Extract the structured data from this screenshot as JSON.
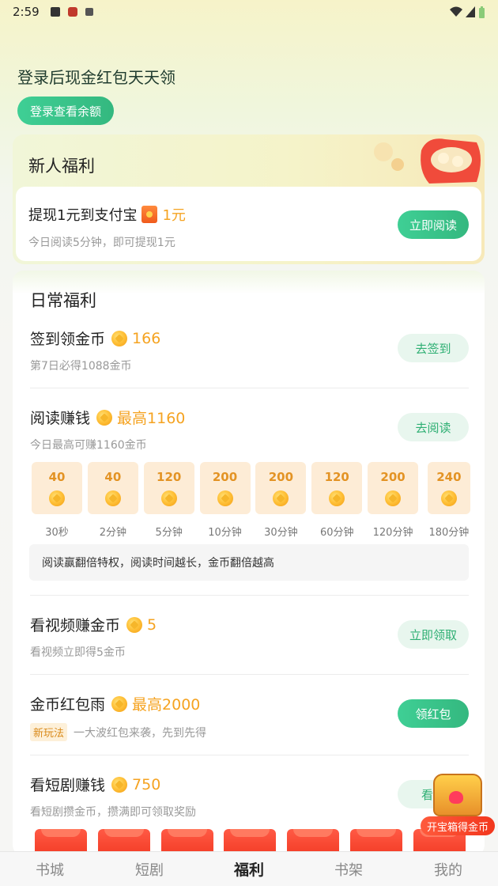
{
  "status": {
    "time": "2:59",
    "indicator_icons": [
      "stop-icon",
      "app-icon",
      "a-icon"
    ],
    "right_icons": [
      "wifi-icon",
      "signal-icon",
      "battery-icon"
    ]
  },
  "hero": {
    "title": "登录后现金红包天天领",
    "login_label": "登录查看余额"
  },
  "newbie": {
    "title": "新人福利",
    "task": {
      "title_prefix": "提现1元到支付宝",
      "amount": "1元",
      "desc": "今日阅读5分钟，即可提现1元",
      "button": "立即阅读"
    }
  },
  "daily": {
    "title": "日常福利",
    "checkin": {
      "name": "签到领金币",
      "reward": "166",
      "desc": "第7日必得1088金币",
      "button": "去签到"
    },
    "read": {
      "name": "阅读赚钱",
      "reward": "最高1160",
      "desc": "今日最高可赚1160金币",
      "button": "去阅读",
      "tiers": [
        {
          "value": "40",
          "label": "30秒"
        },
        {
          "value": "40",
          "label": "2分钟"
        },
        {
          "value": "120",
          "label": "5分钟"
        },
        {
          "value": "200",
          "label": "10分钟"
        },
        {
          "value": "200",
          "label": "30分钟"
        },
        {
          "value": "120",
          "label": "60分钟"
        },
        {
          "value": "200",
          "label": "120分钟"
        },
        {
          "value": "240",
          "label": "180分钟"
        }
      ],
      "tip": "阅读赢翻倍特权，阅读时间越长，金币翻倍越高"
    },
    "video": {
      "name": "看视频赚金币",
      "reward": "5",
      "desc": "看视频立即得5金币",
      "button": "立即领取"
    },
    "rain": {
      "name": "金币红包雨",
      "reward": "最高2000",
      "tag": "新玩法",
      "desc": "一大波红包来袭，先到先得",
      "button": "领红包"
    },
    "drama": {
      "name": "看短剧赚钱",
      "reward": "750",
      "desc": "看短剧攒金币，攒满即可领取奖励",
      "button": "看短"
    }
  },
  "chest": {
    "label": "开宝箱得金币"
  },
  "tabs": [
    {
      "label": "书城",
      "active": false
    },
    {
      "label": "短剧",
      "active": false
    },
    {
      "label": "福利",
      "active": true
    },
    {
      "label": "书架",
      "active": false
    },
    {
      "label": "我的",
      "active": false
    }
  ],
  "colors": {
    "accent_green": "#3fcf95",
    "reward_orange": "#f5a321"
  }
}
